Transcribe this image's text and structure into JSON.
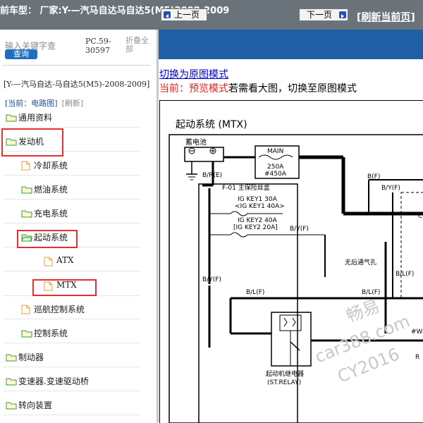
{
  "header": {
    "title": "前车型：  厂家:Y-—汽马自达马自达5(M5)2008-2009"
  },
  "search": {
    "placeholder": "输入关键字查",
    "button_label": "查询"
  },
  "pc_code": "PC.59-30597",
  "collapse_all": "折叠全部",
  "car_info": "[Y-—汽马自达-马自达5(M5)-2008-2009]",
  "current": {
    "label": "[当前：",
    "value": "电路图]",
    "refresh": "[刷新]"
  },
  "tree": [
    {
      "label": "通用资料",
      "icon": "folder-icon"
    },
    {
      "label": "发动机",
      "icon": "folder-icon",
      "highlighted": true
    },
    {
      "label": "冷却系统",
      "icon": "page-icon"
    },
    {
      "label": "燃油系统",
      "icon": "folder-icon"
    },
    {
      "label": "充电系统",
      "icon": "folder-icon"
    },
    {
      "label": "起动系统",
      "icon": "folder-open-icon",
      "highlighted": true
    },
    {
      "label": "ATX",
      "icon": "page-icon"
    },
    {
      "label": "MTX",
      "icon": "page-icon",
      "highlighted": true
    },
    {
      "label": "巡航控制系统",
      "icon": "page-icon"
    },
    {
      "label": "控制系统",
      "icon": "folder-icon"
    },
    {
      "label": "制动器",
      "icon": "folder-icon"
    },
    {
      "label": "变速器.变速驱动桥",
      "icon": "folder-icon"
    },
    {
      "label": "转向装置",
      "icon": "folder-icon"
    }
  ],
  "nav": {
    "prev": "上一页",
    "next": "下一页",
    "refresh": "[刷新当前页]"
  },
  "content": {
    "switch_link": "切换为原图模式",
    "current_prefix": "当前：",
    "current_mode": "预览模式",
    "hint": "若需看大图，切换至原图模式"
  },
  "diagram": {
    "title": "起动系统 (MTX)",
    "battery": "蓄电池",
    "main_fuse": "MAIN",
    "main_rating": "250A",
    "main_rating2": "#450A",
    "fuse_box": "F-01 主保险丝盒",
    "ig1": "IG KEY1 30A",
    "ig1b": "<IG KEY1 40A>",
    "ig2": "IG KEY2 40A",
    "ig2b": "[IG KEY2 20A]",
    "wire_br_e": "B/R(E)",
    "wire_b_f": "B(F)",
    "wire_by_f": "B/Y(F)",
    "wire_bl_f": "B/L(F)",
    "no_vent": "无后通气孔",
    "relay": "起动机继电器",
    "relay_code": "(ST.RELAY)",
    "watermark1": "畅易",
    "watermark2": "car388.com",
    "watermark3": "CY2016",
    "wire_right_r": "R",
    "wire_right_w": "#W",
    "wire_right_c": "C"
  },
  "colors": {
    "topbar": "#6a727a",
    "navbar": "#1e5fa6",
    "highlight": "#e03030",
    "link": "#0000cc"
  }
}
